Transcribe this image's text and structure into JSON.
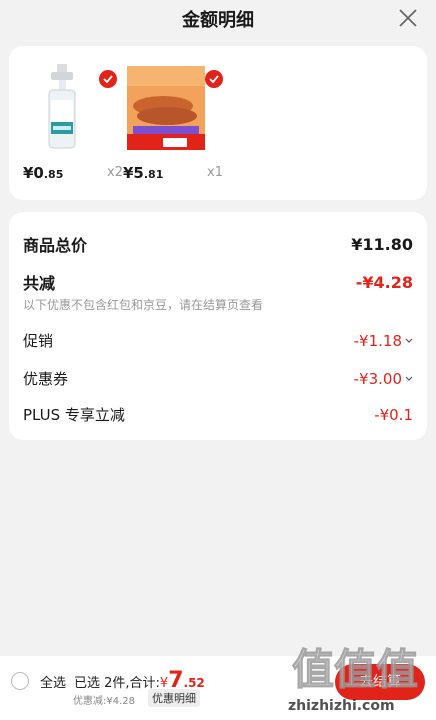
{
  "header": {
    "title": "金额明细",
    "close_icon": "close-icon"
  },
  "products": [
    {
      "price_int": "¥0",
      "price_dec": ".85",
      "qty": "x2",
      "image": "spray-bottle"
    },
    {
      "price_int": "¥5",
      "price_dec": ".81",
      "qty": "x1",
      "image": "sausage-pack"
    }
  ],
  "summary": {
    "total_label": "商品总价",
    "total_value": "¥11.80",
    "reduce_label": "共减",
    "reduce_value": "-¥4.28",
    "note": "以下优惠不包含红包和京豆，请在结算页查看",
    "promo_label": "促销",
    "promo_value": "-¥1.18",
    "coupon_label": "优惠券",
    "coupon_value": "-¥3.00",
    "plus_label": "PLUS 专享立减",
    "plus_value": "-¥0.1"
  },
  "bottom": {
    "select_all": "全选",
    "selected": "已选 2件,合计:",
    "total_yen": "¥",
    "total_int": "7",
    "total_dec": ".52",
    "discount": "优惠减:¥4.28",
    "detail_button": "优惠明细",
    "checkout": "去结算"
  },
  "watermark": {
    "top": "值",
    "bottom": "zhizhizhi.com"
  },
  "colors": {
    "accent": "#e2231a"
  }
}
